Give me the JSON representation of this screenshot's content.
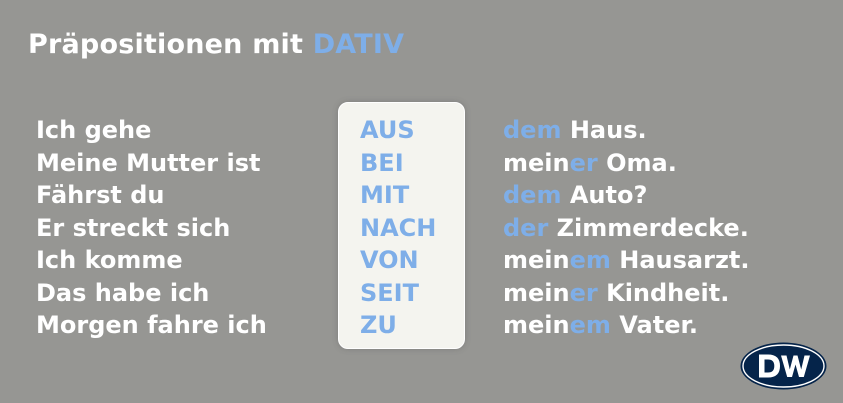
{
  "title": {
    "prefix": "Präpositionen mit ",
    "highlight": "DATIV"
  },
  "sentences": [
    {
      "start": "Ich gehe",
      "preposition": "AUS",
      "end_accent": "dem",
      "end_rest": " Haus.",
      "end_prefix": ""
    },
    {
      "start": "Meine Mutter ist",
      "preposition": "BEI",
      "end_prefix": "mein",
      "end_accent": "er",
      "end_rest": " Oma."
    },
    {
      "start": "Fährst du",
      "preposition": "MIT",
      "end_prefix": "",
      "end_accent": "dem",
      "end_rest": " Auto?"
    },
    {
      "start": "Er streckt sich",
      "preposition": "NACH",
      "end_prefix": "",
      "end_accent": "der",
      "end_rest": " Zimmerdecke."
    },
    {
      "start": "Ich komme",
      "preposition": "VON",
      "end_prefix": "mein",
      "end_accent": "em",
      "end_rest": " Hausarzt."
    },
    {
      "start": "Das habe ich",
      "preposition": "SEIT",
      "end_prefix": "mein",
      "end_accent": "er",
      "end_rest": " Kindheit."
    },
    {
      "start": "Morgen fahre ich",
      "preposition": "ZU",
      "end_prefix": "mein",
      "end_accent": "em",
      "end_rest": " Vater."
    }
  ],
  "logo": {
    "icon": "dw-logo-icon",
    "color": "#05244a"
  },
  "colors": {
    "background": "#969693",
    "accent": "#7eaee8",
    "text": "#ffffff",
    "box": "#f4f4ef"
  }
}
